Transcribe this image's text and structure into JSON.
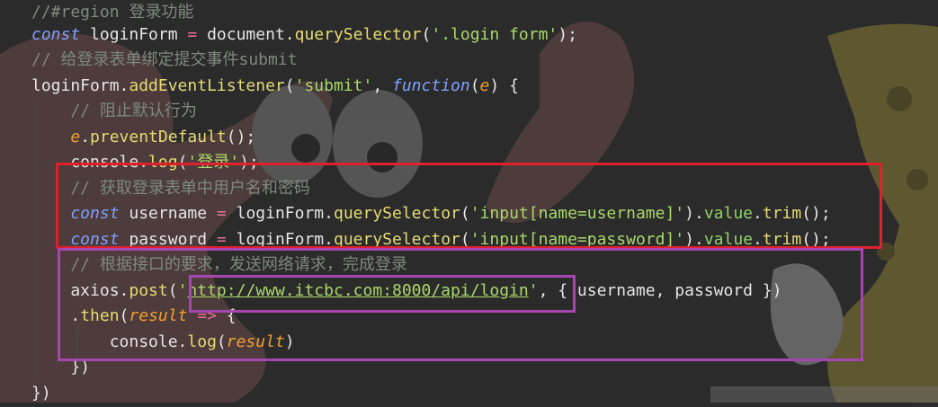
{
  "code": {
    "lines": [
      {
        "tokens": [
          {
            "c": "t-comment",
            "t": "//#region 登录功能"
          }
        ]
      },
      {
        "tokens": [
          {
            "c": "t-kw",
            "t": "const"
          },
          {
            "c": "t-ident",
            "t": " loginForm "
          },
          {
            "c": "t-op",
            "t": "="
          },
          {
            "c": "t-ident",
            "t": " document."
          },
          {
            "c": "t-fn",
            "t": "querySelector"
          },
          {
            "c": "t-punc",
            "t": "("
          },
          {
            "c": "t-str",
            "t": "'.login form'"
          },
          {
            "c": "t-punc",
            "t": ");"
          }
        ]
      },
      {
        "tokens": [
          {
            "c": "t-comment",
            "t": "// 给登录表单绑定提交事件submit"
          }
        ]
      },
      {
        "tokens": [
          {
            "c": "t-ident",
            "t": "loginForm."
          },
          {
            "c": "t-fn",
            "t": "addEventListener"
          },
          {
            "c": "t-punc",
            "t": "("
          },
          {
            "c": "t-str",
            "t": "'submit'"
          },
          {
            "c": "t-punc",
            "t": ", "
          },
          {
            "c": "t-kw",
            "t": "function"
          },
          {
            "c": "t-punc",
            "t": "("
          },
          {
            "c": "t-param",
            "t": "e"
          },
          {
            "c": "t-punc",
            "t": ") {"
          }
        ]
      },
      {
        "tokens": [
          {
            "c": "t-comment",
            "t": "    // 阻止默认行为"
          }
        ]
      },
      {
        "tokens": [
          {
            "c": "t-param",
            "t": "    e"
          },
          {
            "c": "t-punc",
            "t": "."
          },
          {
            "c": "t-fn",
            "t": "preventDefault"
          },
          {
            "c": "t-punc",
            "t": "();"
          }
        ]
      },
      {
        "tokens": [
          {
            "c": "t-ident",
            "t": "    console."
          },
          {
            "c": "t-fn",
            "t": "log"
          },
          {
            "c": "t-punc",
            "t": "("
          },
          {
            "c": "t-str",
            "t": "'登录'"
          },
          {
            "c": "t-punc",
            "t": ");"
          }
        ]
      },
      {
        "tokens": [
          {
            "c": "t-comment",
            "t": "    // 获取登录表单中用户名和密码"
          }
        ]
      },
      {
        "tokens": [
          {
            "c": "t-kw",
            "t": "    const"
          },
          {
            "c": "t-ident",
            "t": " username "
          },
          {
            "c": "t-op",
            "t": "="
          },
          {
            "c": "t-ident",
            "t": " loginForm."
          },
          {
            "c": "t-fn",
            "t": "querySelector"
          },
          {
            "c": "t-punc",
            "t": "("
          },
          {
            "c": "t-str",
            "t": "'input[name=username]'"
          },
          {
            "c": "t-punc",
            "t": ")."
          },
          {
            "c": "t-prop",
            "t": "value"
          },
          {
            "c": "t-punc",
            "t": "."
          },
          {
            "c": "t-fn",
            "t": "trim"
          },
          {
            "c": "t-punc",
            "t": "();"
          }
        ]
      },
      {
        "tokens": [
          {
            "c": "t-kw",
            "t": "    const"
          },
          {
            "c": "t-ident",
            "t": " password "
          },
          {
            "c": "t-op",
            "t": "="
          },
          {
            "c": "t-ident",
            "t": " loginForm."
          },
          {
            "c": "t-fn",
            "t": "querySelector"
          },
          {
            "c": "t-punc",
            "t": "("
          },
          {
            "c": "t-str",
            "t": "'input[name=password]'"
          },
          {
            "c": "t-punc",
            "t": ")."
          },
          {
            "c": "t-prop",
            "t": "value"
          },
          {
            "c": "t-punc",
            "t": "."
          },
          {
            "c": "t-fn",
            "t": "trim"
          },
          {
            "c": "t-punc",
            "t": "();"
          }
        ]
      },
      {
        "tokens": [
          {
            "c": "t-comment",
            "t": "    // 根据接口的要求，发送网络请求，完成登录"
          }
        ]
      },
      {
        "tokens": [
          {
            "c": "t-ident",
            "t": "    axios."
          },
          {
            "c": "t-fn",
            "t": "post"
          },
          {
            "c": "t-punc",
            "t": "("
          },
          {
            "c": "t-str",
            "t": "'"
          },
          {
            "c": "t-url",
            "t": "http://www.itcbc.com:8000/api/login"
          },
          {
            "c": "t-str",
            "t": "'"
          },
          {
            "c": "t-punc",
            "t": ", { username, password })"
          }
        ]
      },
      {
        "tokens": [
          {
            "c": "t-punc",
            "t": "    ."
          },
          {
            "c": "t-fn",
            "t": "then"
          },
          {
            "c": "t-punc",
            "t": "("
          },
          {
            "c": "t-param",
            "t": "result"
          },
          {
            "c": "t-op",
            "t": " =>"
          },
          {
            "c": "t-punc",
            "t": " {"
          }
        ]
      },
      {
        "tokens": [
          {
            "c": "t-ident",
            "t": "        console."
          },
          {
            "c": "t-fn",
            "t": "log"
          },
          {
            "c": "t-punc",
            "t": "("
          },
          {
            "c": "t-param",
            "t": "result"
          },
          {
            "c": "t-punc",
            "t": ")"
          }
        ]
      },
      {
        "tokens": [
          {
            "c": "t-punc",
            "t": "    })"
          }
        ]
      },
      {
        "tokens": [
          {
            "c": "t-punc",
            "t": "})"
          }
        ]
      }
    ]
  },
  "colors": {
    "background": "#2b2b2b",
    "red_highlight": "#e0202a",
    "purple_highlight": "#a646b0"
  }
}
